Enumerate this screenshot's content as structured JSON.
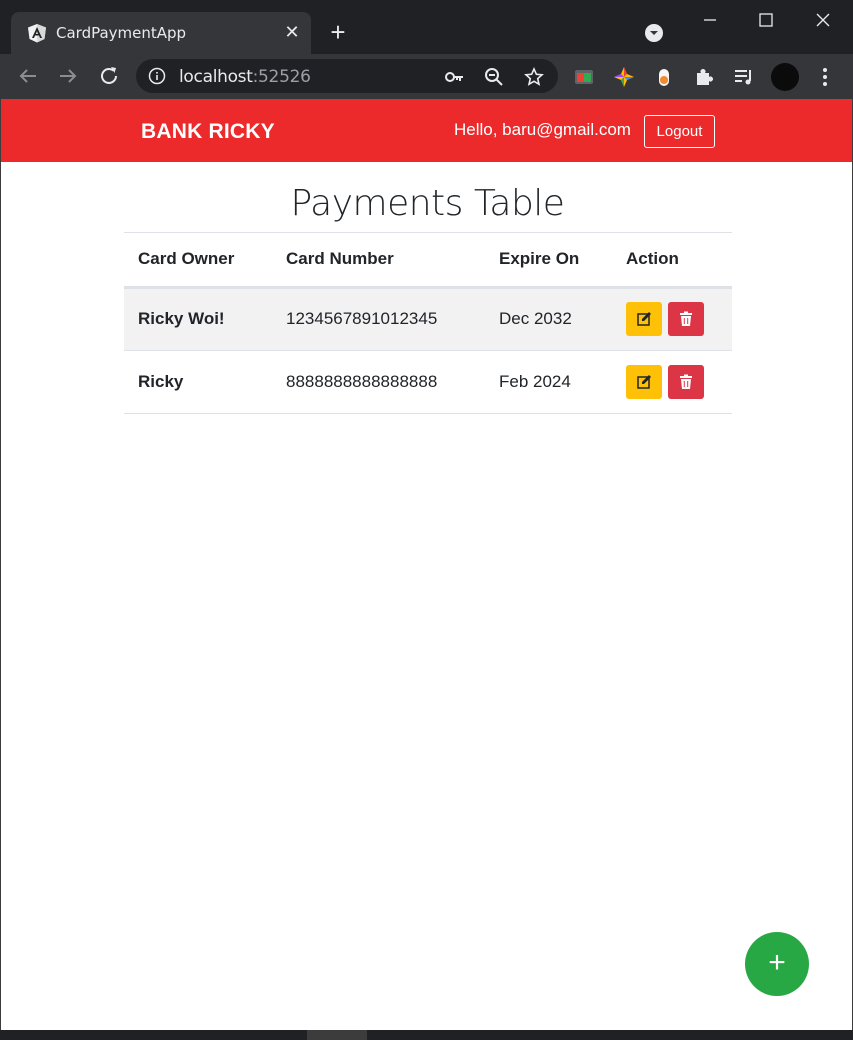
{
  "browser": {
    "tab_title": "CardPaymentApp",
    "url_host": "localhost",
    "url_port": ":52526"
  },
  "navbar": {
    "brand": "BANK RICKY",
    "greeting": "Hello, baru@gmail.com",
    "logout_label": "Logout",
    "color": "#ec2a2c"
  },
  "page": {
    "title": "Payments Table"
  },
  "table": {
    "headers": [
      "Card Owner",
      "Card Number",
      "Expire On",
      "Action"
    ],
    "rows": [
      {
        "owner": "Ricky Woi!",
        "number": "1234567891012345",
        "expire": "Dec 2032"
      },
      {
        "owner": "Ricky",
        "number": "8888888888888888",
        "expire": "Feb 2024"
      }
    ]
  },
  "colors": {
    "edit": "#ffc107",
    "delete": "#dc3545",
    "fab": "#28a745"
  },
  "fab": {
    "label": "+",
    "icon": "plus-icon"
  }
}
